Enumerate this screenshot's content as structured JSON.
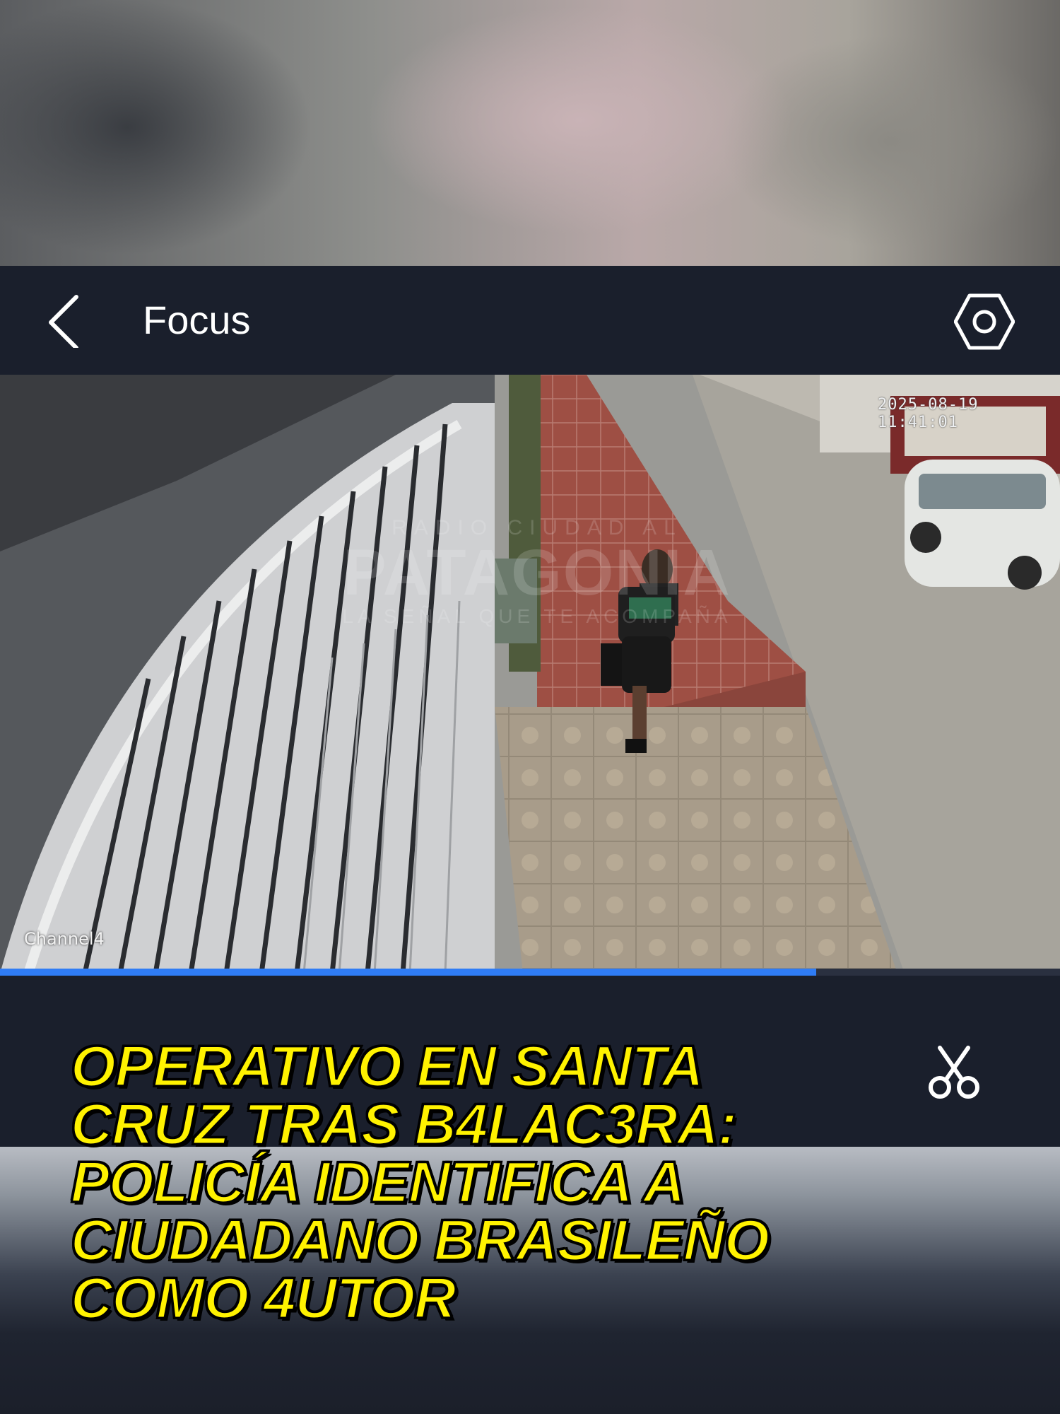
{
  "app": {
    "title": "Focus",
    "back_icon": "chevron-left-icon",
    "settings_icon": "hexagon-settings-icon"
  },
  "video": {
    "timestamp": "2025-08-19 11:41:01",
    "channel": "Channel4",
    "watermark": {
      "line1": "RADIO CIUDAD AL",
      "line2": "PATAGONIA",
      "line3": "LA SEÑAL QUE TE ACOMPAÑA"
    },
    "progress": 0.77
  },
  "controls": {
    "clip_icon": "scissors-icon"
  },
  "headline": {
    "lines": [
      "OPERATIVO EN SANTA",
      "CRUZ TRAS B4LAC3RA:",
      "POLICÍA IDENTIFICA A",
      "CIUDADANO BRASILEÑO",
      "COMO 4UTOR"
    ]
  },
  "colors": {
    "header_bg": "#1a1f2c",
    "progress": "#2f7cf5",
    "headline_text": "#fff200"
  }
}
